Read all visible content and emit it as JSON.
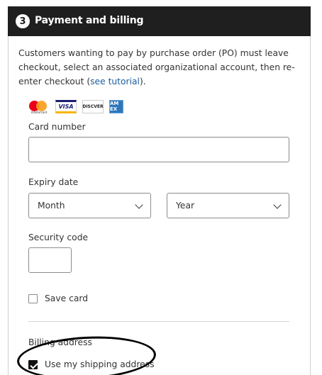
{
  "header": {
    "step_number": "3",
    "title": "Payment and billing"
  },
  "intro": {
    "text_before": "Customers wanting to pay by purchase order (PO) must leave checkout, select an associated organizational account, then re-enter checkout (",
    "link_text": "see tutorial",
    "text_after": ")."
  },
  "card_logos": {
    "mastercard": "mastercard",
    "visa": "VISA",
    "discover": "DISC",
    "discover_tail": "VER",
    "amex": "AM EX"
  },
  "form": {
    "card_number_label": "Card number",
    "card_number_value": "",
    "expiry_label": "Expiry date",
    "month_selected": "Month",
    "year_selected": "Year",
    "security_label": "Security code",
    "security_value": "",
    "save_card_label": "Save card",
    "save_card_checked": false,
    "billing_address_label": "Billing address",
    "use_shipping_label": "Use my shipping address",
    "use_shipping_checked": true
  },
  "colors": {
    "header_bg": "#1f1f1f",
    "link": "#1a5ea0",
    "annotation": "#000000"
  }
}
